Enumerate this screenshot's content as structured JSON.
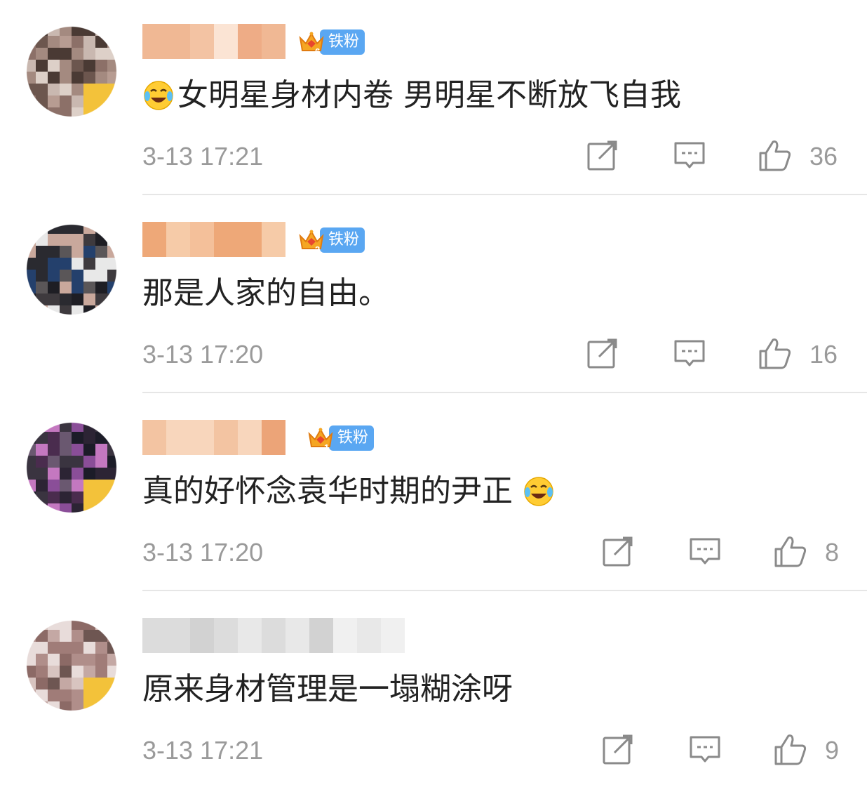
{
  "comments": [
    {
      "badge_level": "6",
      "badge_label": "铁粉",
      "text": "女明星身材内卷 男明星不断放飞自我",
      "time": "3-13 17:21",
      "likes": "36"
    },
    {
      "badge_level": "2",
      "badge_label": "铁粉",
      "text": "那是人家的自由。",
      "time": "3-13 17:20",
      "likes": "16"
    },
    {
      "badge_level": "1",
      "badge_label": "铁粉",
      "text": "真的好怀念袁华时期的尹正",
      "time": "3-13 17:20",
      "likes": "8"
    },
    {
      "text": "原来身材管理是一塌糊涂呀",
      "time": "3-13 17:21",
      "likes": "9"
    }
  ],
  "icons": {
    "share": "share-icon",
    "comment": "comment-icon",
    "like": "thumbs-up-icon",
    "emoji": "laughing-tears-emoji"
  },
  "colors": {
    "text": "#222222",
    "meta": "#9a9a9a",
    "badge_blue": "#5aa7f2",
    "divider": "#e6e6e6"
  }
}
